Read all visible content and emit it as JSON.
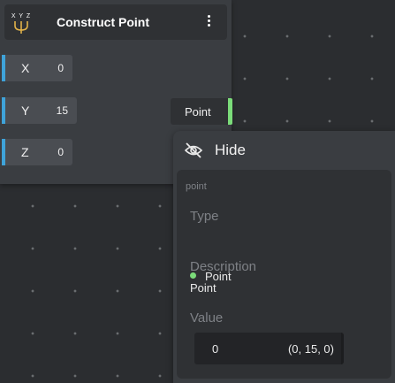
{
  "node": {
    "title": "Construct Point",
    "icon_text": "X Y Z",
    "icon": "xyz-fork-icon",
    "menu_icon": "vertical-dots-icon",
    "inputs": [
      {
        "name": "X",
        "value": "0"
      },
      {
        "name": "Y",
        "value": "15"
      },
      {
        "name": "Z",
        "value": "0"
      }
    ],
    "output": {
      "label": "Point"
    }
  },
  "popover": {
    "hide_label": "Hide",
    "hide_icon": "eye-slash-icon",
    "port_name": "point",
    "type_heading": "Type",
    "type_value": "Point",
    "description_heading": "Description",
    "description_value": "Point",
    "value_heading": "Value",
    "value_index": "0",
    "value_text": "(0, 15, 0)"
  },
  "colors": {
    "background": "#2b2d30",
    "node": "#3a3d41",
    "input_accent": "#3fa3d9",
    "output_accent": "#7bdc7a",
    "icon_accent": "#e2b34a"
  }
}
